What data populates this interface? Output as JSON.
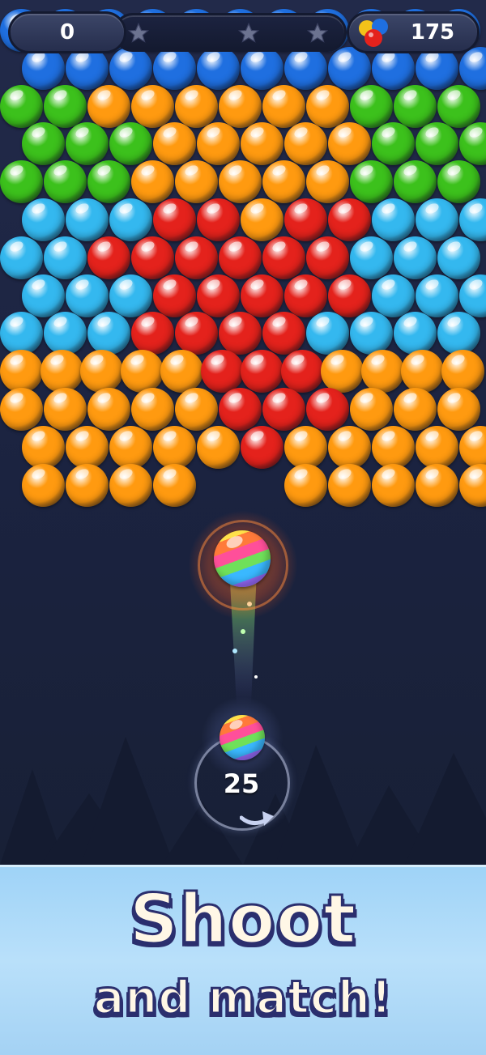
{
  "hud": {
    "score": "0",
    "stars_total": 3,
    "coins": "175"
  },
  "launcher": {
    "shots_left": "25"
  },
  "banner": {
    "line1": "Shoot",
    "line2": "and match!"
  },
  "colors": {
    "blue": "#1f6fe0",
    "green": "#3cc11c",
    "orange": "#ff9a10",
    "red": "#e4221c",
    "cyan": "#34b8ef",
    "background": "#1c2340",
    "banner": "#a9d6f6"
  },
  "board": {
    "rows": [
      "BBBBBBBBBBB",
      "BBBBBBBBBBB",
      "GGOOOOOOGGG",
      "GGGOOOOOGGG",
      "GGGOOOOOGGG",
      "CCCRRORRCCC",
      "CCRRRRRRCCC",
      "CCCRRRRRCCC",
      "CCCRRRRCCCC",
      "OOOOORRROOOO",
      "OOOOORRROOO",
      "OOOOOROOOOO",
      "OOOO.OOOOO"
    ]
  }
}
